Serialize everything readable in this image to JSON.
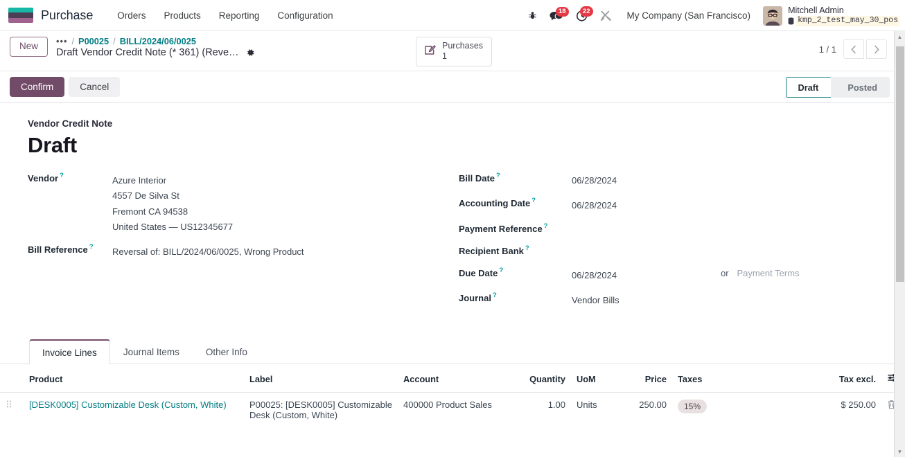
{
  "navbar": {
    "brand": "Purchase",
    "logo_colors": [
      "#16b7a5",
      "#4a3f55",
      "#a0628f"
    ],
    "menu": [
      {
        "label": "Orders"
      },
      {
        "label": "Products"
      },
      {
        "label": "Reporting"
      },
      {
        "label": "Configuration"
      }
    ],
    "sys_icons": [
      {
        "name": "bug-icon",
        "glyph": "☣",
        "badge": ""
      },
      {
        "name": "messages-icon",
        "glyph": "💬",
        "badge": "18"
      },
      {
        "name": "activities-clock-icon",
        "glyph": "🕓",
        "badge": "22"
      },
      {
        "name": "tools-icon",
        "glyph": "✕",
        "badge": ""
      }
    ],
    "company": "My Company (San Francisco)",
    "user_name": "Mitchell Admin",
    "database": "kmp_2_test_may_30_pos",
    "badge_color": "#e63946"
  },
  "control_panel": {
    "new_button": "New",
    "breadcrumb_dots": "•••",
    "breadcrumb_links": [
      "P00025",
      "BILL/2024/06/0025"
    ],
    "breadcrumb_separator": "/",
    "current_record": "Draft Vendor Credit Note (* 361) (Reve…",
    "stat_button": {
      "label": "Purchases",
      "value": "1",
      "icon": "edit-square-icon"
    },
    "pager": {
      "count": "1 / 1",
      "prev": "‹",
      "next": "›"
    }
  },
  "statusbar": {
    "confirm_label": "Confirm",
    "cancel_label": "Cancel",
    "primary_color": "#714B67",
    "stages": [
      {
        "label": "Draft",
        "active": true
      },
      {
        "label": "Posted",
        "active": false
      }
    ],
    "active_border_color": "#1a7f86"
  },
  "form": {
    "doc_kind": "Vendor Credit Note",
    "doc_title": "Draft",
    "left_fields": [
      {
        "label": "Vendor",
        "help": "?",
        "lines": [
          "Azure Interior",
          "4557 De Silva St",
          "Fremont CA 94538",
          "United States — US12345677"
        ]
      },
      {
        "label": "Bill Reference",
        "help": "?",
        "lines": [
          "Reversal of: BILL/2024/06/0025, Wrong Product"
        ]
      }
    ],
    "right_fields": [
      {
        "label": "Bill Date",
        "help": "?",
        "value": "06/28/2024"
      },
      {
        "label": "Accounting Date",
        "help": "?",
        "value": "06/28/2024"
      },
      {
        "label": "Payment Reference",
        "help": "?",
        "value": ""
      },
      {
        "label": "Recipient Bank",
        "help": "?",
        "value": ""
      },
      {
        "label": "Due Date",
        "help": "?",
        "value": "06/28/2024",
        "or_word": "or",
        "alt_link": "Payment Terms"
      },
      {
        "label": "Journal",
        "help": "?",
        "value": "Vendor Bills"
      }
    ]
  },
  "notebook": {
    "tabs": [
      {
        "label": "Invoice Lines",
        "active": true
      },
      {
        "label": "Journal Items",
        "active": false
      },
      {
        "label": "Other Info",
        "active": false
      }
    ]
  },
  "lines_table": {
    "columns": [
      {
        "label": "Product",
        "align": "left"
      },
      {
        "label": "Label",
        "align": "left"
      },
      {
        "label": "Account",
        "align": "left"
      },
      {
        "label": "Quantity",
        "align": "right"
      },
      {
        "label": "UoM",
        "align": "left"
      },
      {
        "label": "Price",
        "align": "right"
      },
      {
        "label": "Taxes",
        "align": "left"
      },
      {
        "label": "Tax excl.",
        "align": "right"
      }
    ],
    "optional_columns_icon": "sliders-icon",
    "rows": [
      {
        "product": "[DESK0005] Customizable Desk (Custom, White)",
        "label": "P00025: [DESK0005] Customizable Desk (Custom, White)",
        "account": "400000 Product Sales",
        "quantity": "1.00",
        "uom": "Units",
        "price": "250.00",
        "taxes": "15%",
        "tax_excl": "$ 250.00",
        "delete_icon": "trash-icon"
      }
    ]
  }
}
